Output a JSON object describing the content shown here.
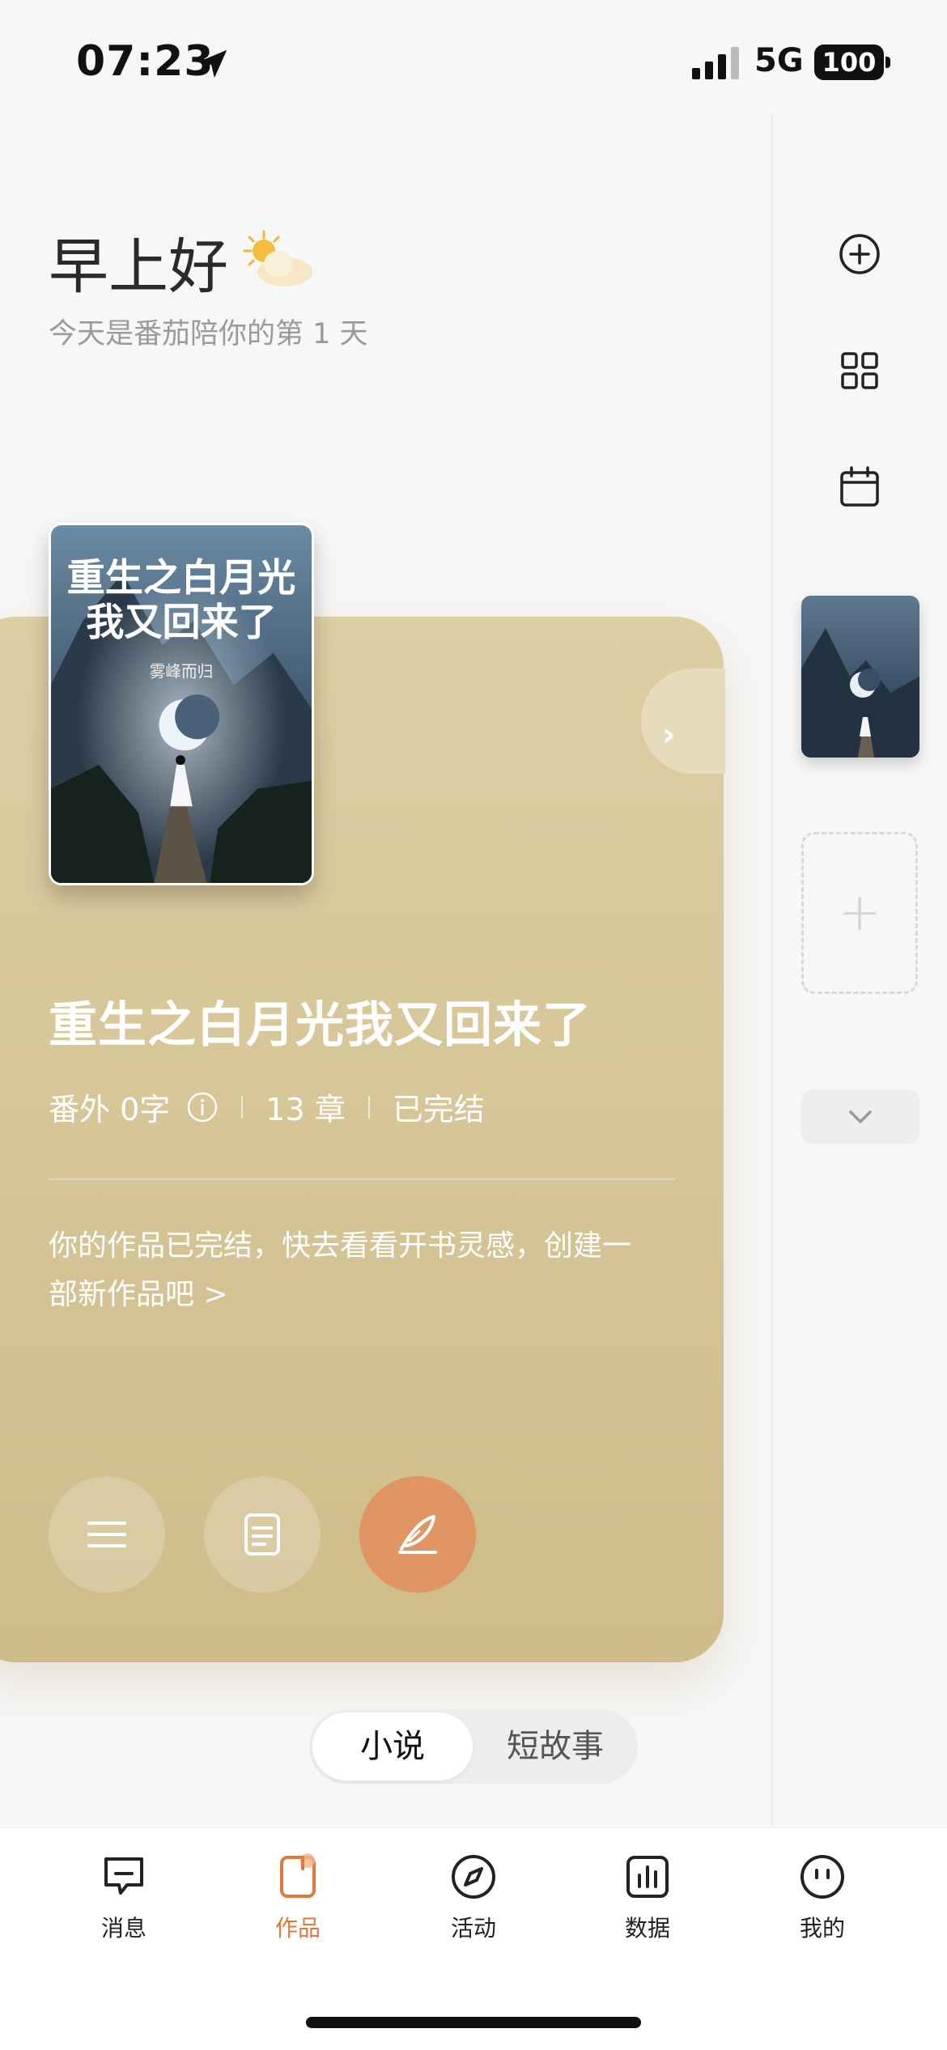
{
  "status_bar": {
    "time": "07:23",
    "network": "5G",
    "battery": "100"
  },
  "greeting": {
    "title": "早上好",
    "subtitle": "今天是番茄陪你的第 1 天"
  },
  "book": {
    "cover_title_line1": "重生之白月光",
    "cover_title_line2": "我又回来了",
    "cover_author": "雾峰而归",
    "title": "重生之白月光我又回来了",
    "extra_words": "番外 0字",
    "chapters": "13 章",
    "status": "已完结",
    "tip": "你的作品已完结，快去看看开书灵感，创建一部新作品吧  >"
  },
  "segment": {
    "novel": "小说",
    "short_story": "短故事",
    "active": "小说"
  },
  "tabbar": {
    "items": [
      {
        "label": "消息",
        "icon": "message-icon"
      },
      {
        "label": "作品",
        "icon": "works-icon",
        "active": true
      },
      {
        "label": "活动",
        "icon": "compass-icon"
      },
      {
        "label": "数据",
        "icon": "chart-icon"
      },
      {
        "label": "我的",
        "icon": "profile-icon"
      }
    ]
  },
  "rail": {
    "add_label": "+"
  },
  "colors": {
    "accent": "#e07a3c",
    "card": "#d6c698",
    "write_button": "#e09562"
  }
}
